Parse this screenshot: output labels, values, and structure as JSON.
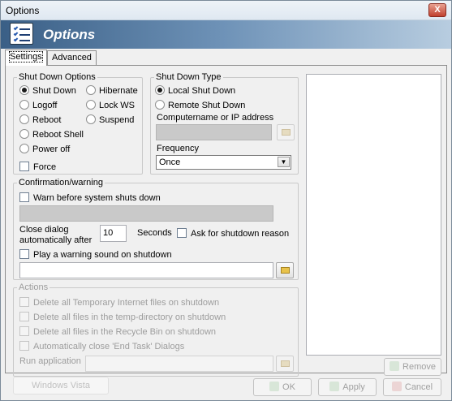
{
  "window": {
    "title": "Options",
    "close_glyph": "X",
    "banner_title": "Options",
    "banner_icon": "checklist-icon"
  },
  "tabs": [
    {
      "label": "Settings",
      "active": true
    },
    {
      "label": "Advanced",
      "active": false
    }
  ],
  "shutdown_options": {
    "title": "Shut Down Options",
    "options": [
      {
        "label": "Shut Down",
        "selected": true
      },
      {
        "label": "Hibernate",
        "selected": false
      },
      {
        "label": "Logoff",
        "selected": false
      },
      {
        "label": "Lock WS",
        "selected": false
      },
      {
        "label": "Reboot",
        "selected": false
      },
      {
        "label": "Suspend",
        "selected": false
      },
      {
        "label": "Reboot Shell",
        "selected": false
      },
      {
        "label": "Power off",
        "selected": false
      }
    ],
    "force_label": "Force",
    "force_checked": false
  },
  "shutdown_type": {
    "title": "Shut Down Type",
    "local_label": "Local Shut Down",
    "remote_label": "Remote Shut Down",
    "local_selected": true,
    "computer_label": "Computername or IP address",
    "computer_value": "",
    "frequency_label": "Frequency",
    "frequency_value": "Once"
  },
  "confirmation": {
    "title": "Confirmation/warning",
    "warn_label": "Warn before system shuts down",
    "warn_checked": false,
    "warn_text": "",
    "close_dialog_label_1": "Close dialog",
    "close_dialog_label_2": "automatically after",
    "seconds_value": "10",
    "seconds_label": "Seconds",
    "ask_reason_label": "Ask for shutdown reason",
    "play_sound_label": "Play a warning sound on shutdown",
    "sound_path": ""
  },
  "actions": {
    "title": "Actions",
    "items": [
      "Delete all Temporary Internet files on shutdown",
      "Delete all files in the temp-directory on shutdown",
      "Delete all files in the Recycle Bin on shutdown",
      "Automatically close 'End Task' Dialogs"
    ],
    "run_label": "Run application",
    "run_value": ""
  },
  "buttons": {
    "remove": "Remove",
    "ok": "OK",
    "apply": "Apply",
    "cancel": "Cancel",
    "style_label": "Windows Vista"
  },
  "colors": {
    "banner_start": "#3a5f86",
    "banner_end": "#b8cde0",
    "disabled_text": "#9d9d9d"
  }
}
